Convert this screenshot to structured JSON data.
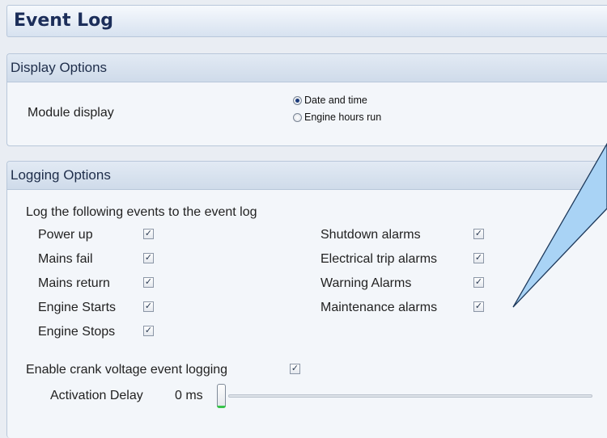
{
  "page": {
    "title": "Event Log"
  },
  "display_options": {
    "header": "Display Options",
    "module_display_label": "Module display",
    "radio_options": [
      {
        "label": "Date and time",
        "selected": true
      },
      {
        "label": "Engine hours run",
        "selected": false
      }
    ]
  },
  "logging_options": {
    "header": "Logging Options",
    "intro": "Log the following events to the event log",
    "left_events": [
      {
        "label": "Power up",
        "checked": true
      },
      {
        "label": "Mains fail",
        "checked": true
      },
      {
        "label": "Mains return",
        "checked": true
      },
      {
        "label": "Engine Starts",
        "checked": true
      },
      {
        "label": "Engine Stops",
        "checked": true
      }
    ],
    "right_events": [
      {
        "label": "Shutdown alarms",
        "checked": true
      },
      {
        "label": "Electrical trip alarms",
        "checked": true
      },
      {
        "label": "Warning Alarms",
        "checked": true
      },
      {
        "label": "Maintenance alarms",
        "checked": true
      }
    ],
    "crank_voltage_label": "Enable crank voltage event logging",
    "crank_voltage_checked": true,
    "activation_delay_label": "Activation Delay",
    "activation_delay_value": "0 ms",
    "activation_delay_fraction": 0
  },
  "colors": {
    "accent_green": "#37c44a",
    "callout_fill": "#a9d3f5",
    "title_text": "#1c2e5a"
  }
}
